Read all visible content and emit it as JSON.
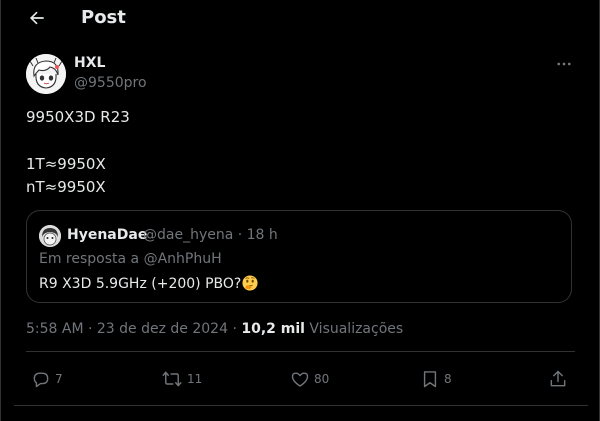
{
  "header": {
    "back_icon": "arrow-left-icon",
    "title": "Post"
  },
  "author": {
    "name": "HXL",
    "handle": "@9550pro",
    "more_icon": "more-horizontal-icon"
  },
  "post": {
    "lines": [
      "9950X3D R23",
      "1T≈9950X",
      "nT≈9950X"
    ]
  },
  "quote": {
    "name": "HyenaDae",
    "handle_time": "@dae_hyena · 18 h",
    "reply_to": "Em resposta a @AnhPhuH",
    "text": "R9 X3D 5.9GHz (+200) PBO?",
    "emoji": "thinking-face-emoji"
  },
  "meta": {
    "time_date": "5:58 AM · 23 de dez de 2024 · ",
    "views_count": "10,2 mil",
    "views_label": " Visualizações"
  },
  "actions": {
    "replies": "7",
    "reposts": "11",
    "likes": "80",
    "bookmarks": "8"
  },
  "colors": {
    "background": "#000000",
    "text": "#e7e9ea",
    "muted": "#71767b",
    "border": "#2f3336"
  }
}
